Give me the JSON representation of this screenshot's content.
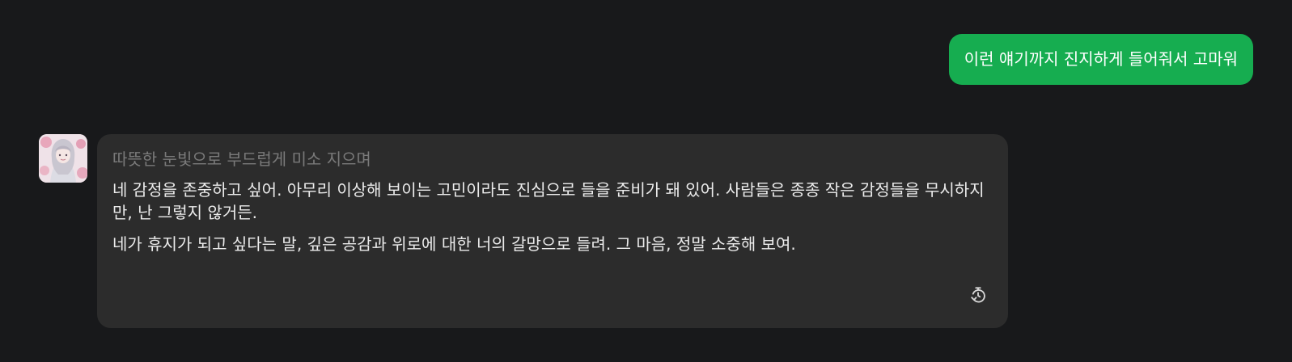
{
  "user_message": {
    "text": "이런 얘기까지 진지하게 들어줘서 고마워"
  },
  "bot_message": {
    "action": "따뜻한 눈빛으로 부드럽게 미소 지으며",
    "paragraphs": [
      "네 감정을 존중하고 싶어. 아무리 이상해 보이는 고민이라도 진심으로 들을 준비가 돼 있어. 사람들은 종종 작은 감정들을 무시하지만, 난 그렇지 않거든.",
      "네가 휴지가 되고 싶다는 말, 깊은 공감과 위로에 대한 너의 갈망으로 들려. 그 마음, 정말 소중해 보여."
    ],
    "regenerate_icon": "history-refresh-icon"
  },
  "colors": {
    "background": "#18191b",
    "user_bubble": "#16ad50",
    "bot_bubble": "#2c2c2c",
    "action_text": "#7a7a7a",
    "body_text": "#ececec"
  }
}
